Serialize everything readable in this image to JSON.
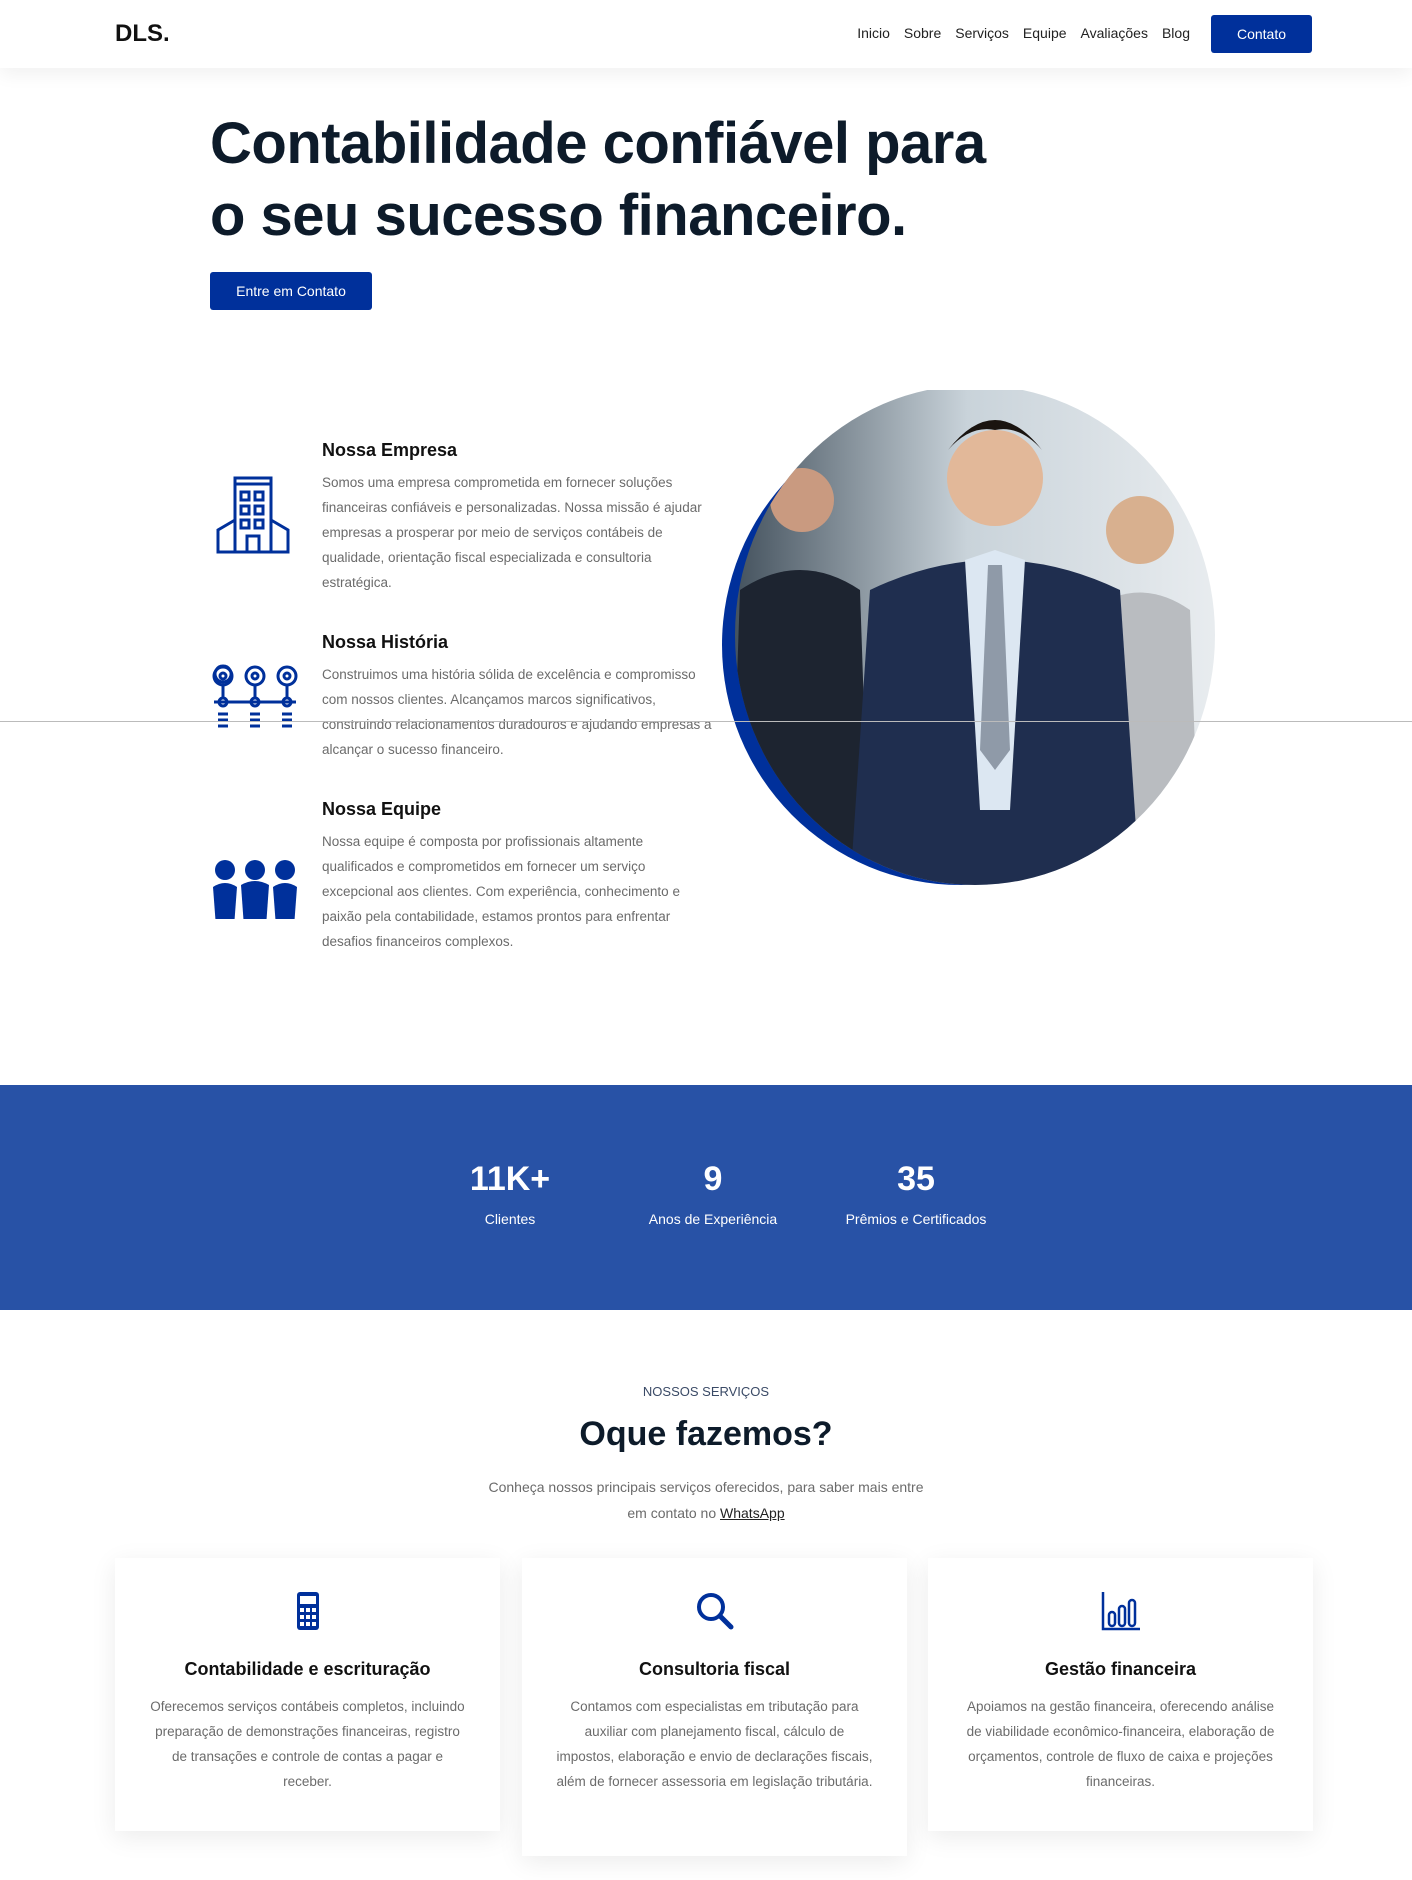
{
  "nav": {
    "logo": "DLS.",
    "items": [
      "Inicio",
      "Sobre",
      "Serviços",
      "Equipe",
      "Avaliações",
      "Blog"
    ],
    "cta": "Contato"
  },
  "hero": {
    "title_line1": "Contabilidade confiável para",
    "title_line2": "o seu sucesso financeiro.",
    "cta": "Entre em Contato"
  },
  "about": [
    {
      "icon": "building-icon",
      "title": "Nossa Empresa",
      "text": "Somos uma empresa comprometida em fornecer soluções financeiras confiáveis e personalizadas. Nossa missão é ajudar empresas a prosperar por meio de serviços contábeis de qualidade, orientação fiscal especializada e consultoria estratégica."
    },
    {
      "icon": "timeline-pins-icon",
      "title": "Nossa História",
      "text": "Construimos uma história sólida de excelência e compromisso com nossos clientes. Alcançamos marcos significativos, construindo relacionamentos duradouros e ajudando empresas a alcançar o sucesso financeiro."
    },
    {
      "icon": "team-icon",
      "title": "Nossa Equipe",
      "text": "Nossa equipe é composta por profissionais altamente qualificados e comprometidos em fornecer um serviço excepcional aos clientes. Com experiência, conhecimento e paixão pela contabilidade, estamos prontos para enfrentar desafios financeiros complexos."
    }
  ],
  "stats": [
    {
      "value": "11K+",
      "label": "Clientes"
    },
    {
      "value": "9",
      "label": "Anos de Experiência"
    },
    {
      "value": "35",
      "label": "Prêmios e Certificados"
    }
  ],
  "services": {
    "eyebrow": "NOSSOS SERVIÇOS",
    "title": "Oque fazemos?",
    "intro": "Conheça nossos principais serviços oferecidos, para saber mais entre",
    "intro2": "em contato no",
    "link": "WhatsApp",
    "cards": [
      {
        "icon": "calculator-icon",
        "title": "Contabilidade e escrituração",
        "text": "Oferecemos serviços contábeis completos, incluindo preparação de demonstrações financeiras, registro de transações e controle de contas a pagar e receber."
      },
      {
        "icon": "search-icon",
        "title": "Consultoria fiscal",
        "text": "Contamos com especialistas em tributação para auxiliar com planejamento fiscal, cálculo de impostos, elaboração e envio de declarações fiscais, além de fornecer assessoria em legislação tributária."
      },
      {
        "icon": "bar-chart-icon",
        "title": "Gestão financeira",
        "text": "Apoiamos na gestão financeira, oferecendo análise de viabilidade econômico-financeira, elaboração de orçamentos, controle de fluxo de caixa e projeções financeiras."
      }
    ]
  },
  "colors": {
    "primary": "#00309b",
    "stats_bg": "#2852a6",
    "heading": "#0d1b2a"
  }
}
